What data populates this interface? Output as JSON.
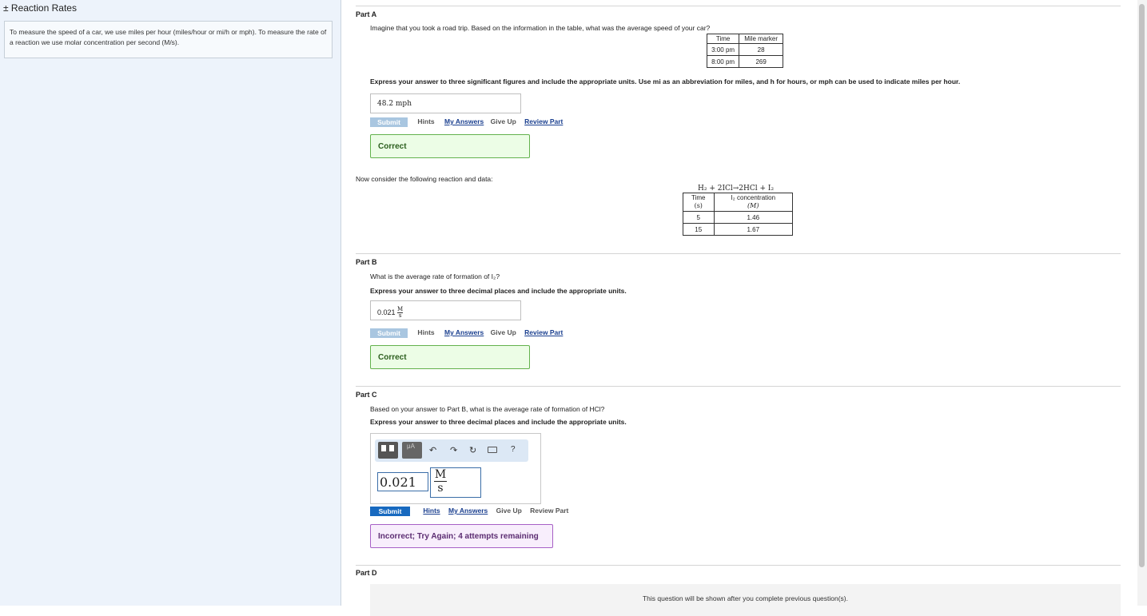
{
  "sidebar": {
    "title": "± Reaction Rates",
    "intro_text": "To measure the speed of a car, we use miles per hour (miles/hour or mi/h or mph). To measure the rate of a reaction we use molar concentration per second (M/s)."
  },
  "part_a": {
    "heading": "Part A",
    "question": "Imagine that you took a road trip. Based on the information in the table, what was the average speed of your car?",
    "table": {
      "headers": [
        "Time",
        "Mile marker"
      ],
      "rows": [
        [
          "3:00 pm",
          "28"
        ],
        [
          "8:00 pm",
          "269"
        ]
      ]
    },
    "instruction": "Express your answer to three significant figures and include the appropriate units. Use mi as an abbreviation for miles, and h for hours, or mph can be used to indicate miles per hour.",
    "answer": "48.2 mph",
    "toolbar": {
      "submit": "Submit",
      "hints": "Hints",
      "my_answers": "My Answers",
      "give_up": "Give Up",
      "review": "Review Part"
    },
    "feedback": "Correct"
  },
  "reaction": {
    "intro": "Now consider the following reaction and data:",
    "equation": "H₂ + 2ICl→2HCl + I₂",
    "table": {
      "header_time": "Time",
      "header_time_unit": "(s)",
      "header_conc": "I₂ concentration",
      "header_conc_unit": "(M)",
      "rows": [
        [
          "5",
          "1.46"
        ],
        [
          "15",
          "1.67"
        ]
      ]
    }
  },
  "part_b": {
    "heading": "Part B",
    "question": "What is the average rate of formation of I₂?",
    "instruction": "Express your answer to three decimal places and include the appropriate units.",
    "answer_value": "0.021",
    "answer_unit_num": "M",
    "answer_unit_den": "s",
    "toolbar": {
      "submit": "Submit",
      "hints": "Hints",
      "my_answers": "My Answers",
      "give_up": "Give Up",
      "review": "Review Part"
    },
    "feedback": "Correct"
  },
  "part_c": {
    "heading": "Part C",
    "question": "Based on your answer to Part B, what is the average rate of formation of HCl?",
    "instruction": "Express your answer to three decimal places and include the appropriate units.",
    "editor": {
      "value": "0.021",
      "unit_num": "M",
      "unit_den": "s",
      "help": "?"
    },
    "toolbar": {
      "submit": "Submit",
      "hints": "Hints",
      "my_answers": "My Answers",
      "give_up": "Give Up",
      "review": "Review Part"
    },
    "feedback": "Incorrect; Try Again; 4 attempts remaining"
  },
  "part_d": {
    "heading": "Part D",
    "placeholder": "This question will be shown after you complete previous question(s)."
  }
}
